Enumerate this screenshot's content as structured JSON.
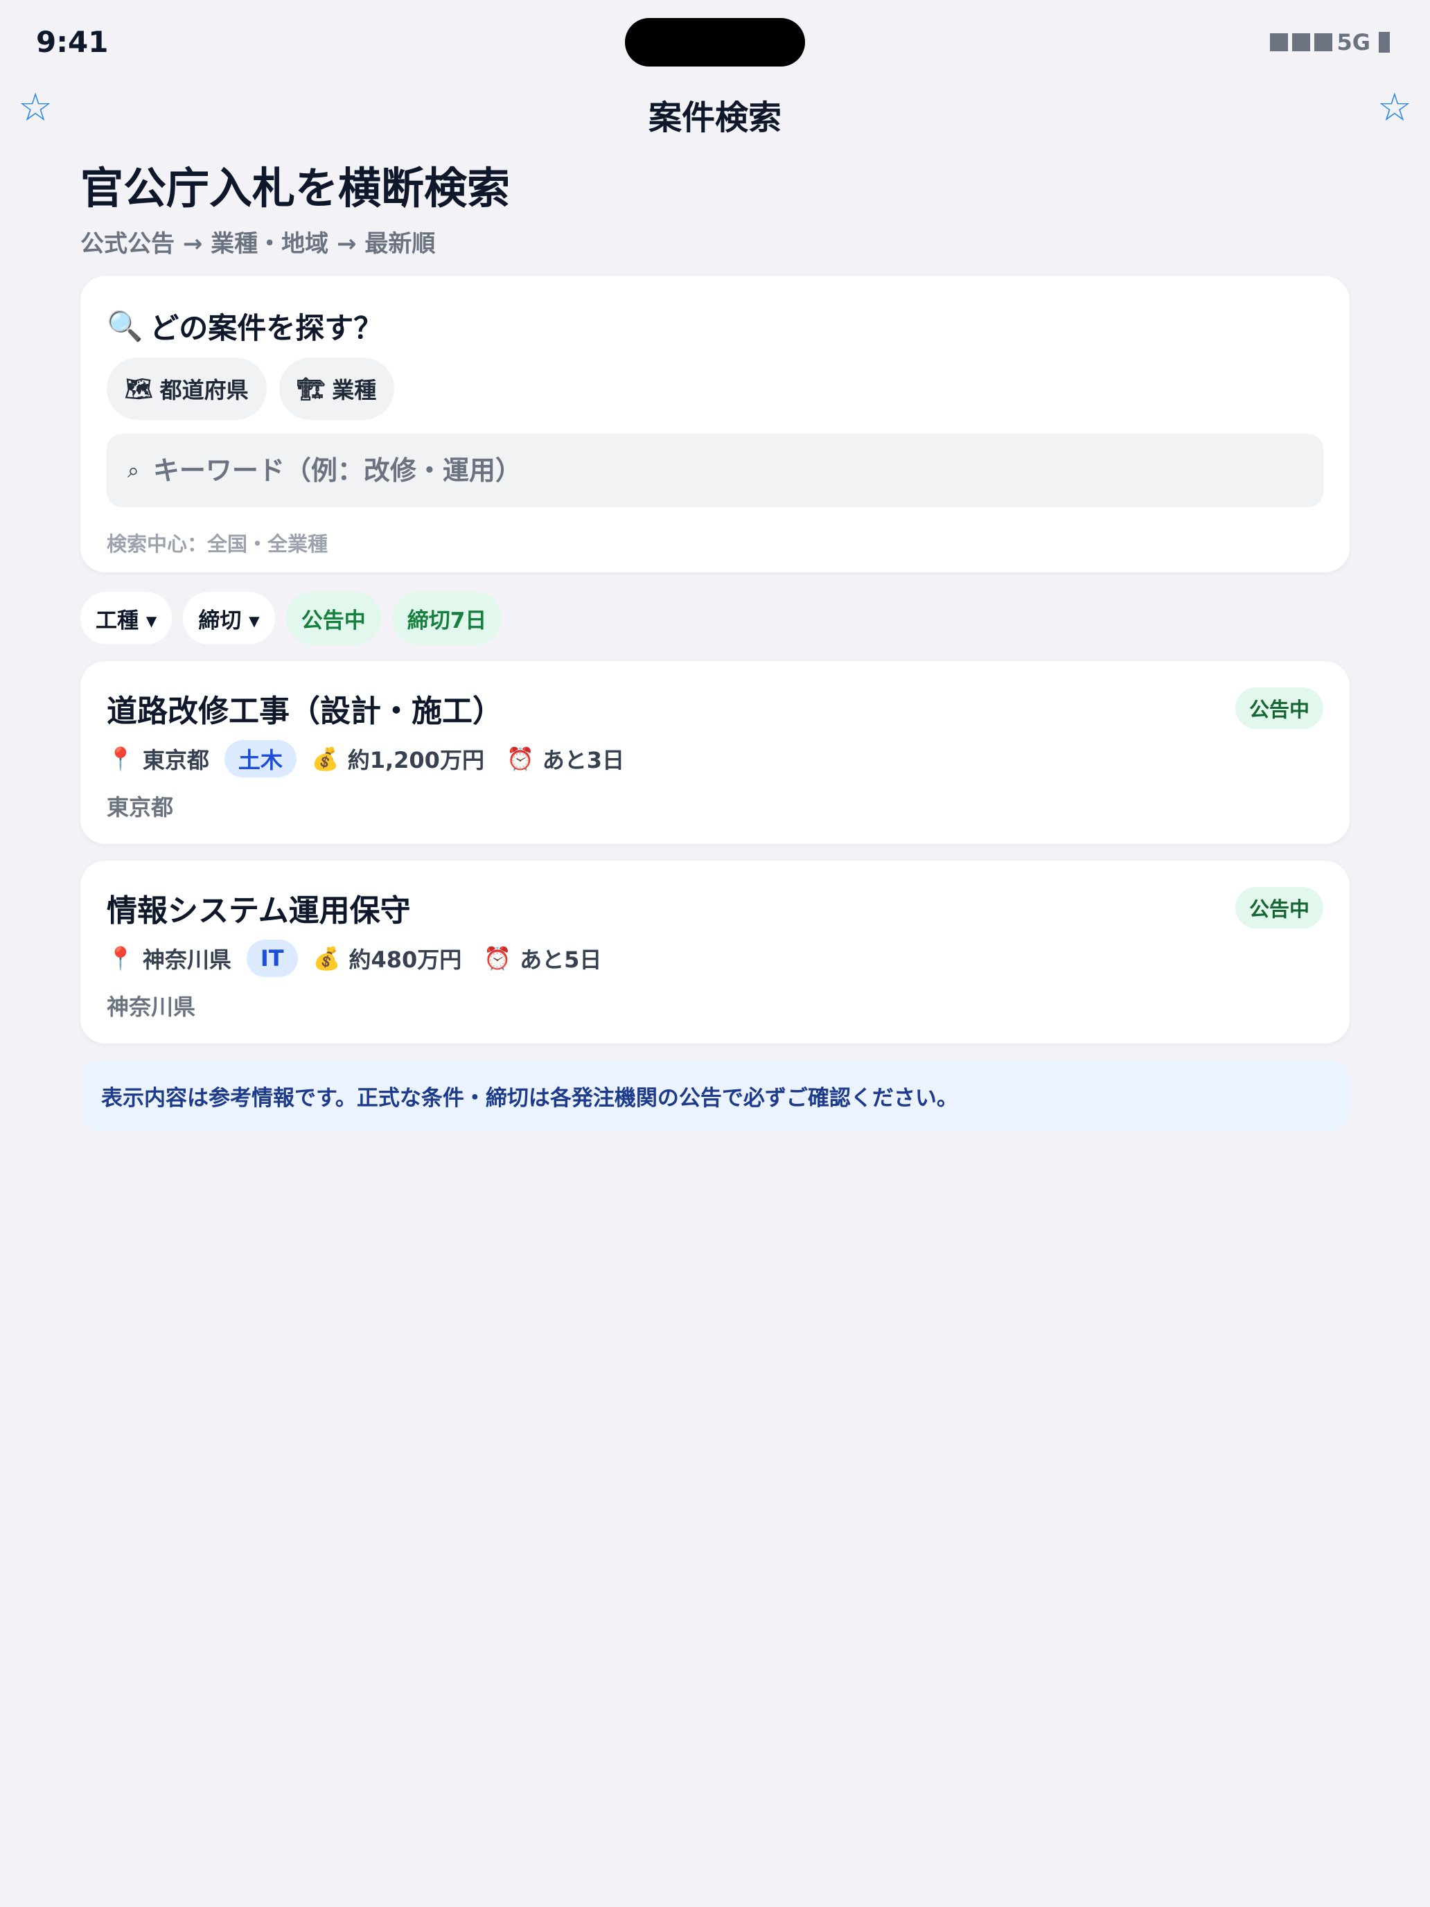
{
  "status_bar": {
    "time": "9:41",
    "network": "5G",
    "signal_icon": "signal-bars-icon",
    "battery_icon": "battery-icon"
  },
  "nav": {
    "title": "案件検索",
    "left_icon": "star-outline-icon",
    "right_icon": "star-outline-icon",
    "star_glyph": "☆",
    "accent_color": "#2b8ae6"
  },
  "hero": {
    "title": "官公庁入札を横断検索",
    "subtitle": "公式公告 → 業種・地域 → 最新順"
  },
  "search": {
    "heading_icon": "🔍",
    "heading": "どの案件を探す？",
    "chips": [
      {
        "icon": "🗺",
        "label": "都道府県",
        "icon_name": "map-icon"
      },
      {
        "icon": "🏗",
        "label": "業種",
        "icon_name": "construction-icon"
      }
    ],
    "keyword_icon": "⌕",
    "keyword_placeholder": "キーワード（例：改修・運用）",
    "keyword_value": "",
    "hint": "検索中心：全国・全業種"
  },
  "filters": [
    {
      "label": "工種 ▾",
      "style": "white"
    },
    {
      "label": "締切 ▾",
      "style": "white"
    },
    {
      "label": "公告中",
      "style": "green"
    },
    {
      "label": "締切7日",
      "style": "green"
    }
  ],
  "tenders": [
    {
      "title": "道路改修工事（設計・施工）",
      "status": "公告中",
      "pin_icon": "📍",
      "prefecture": "東京都",
      "category": "土木",
      "money_icon": "💰",
      "budget": "約1,200万円",
      "clock_icon": "⏰",
      "deadline": "あと3日",
      "location": "東京都"
    },
    {
      "title": "情報システム運用保守",
      "status": "公告中",
      "pin_icon": "📍",
      "prefecture": "神奈川県",
      "category": "IT",
      "money_icon": "💰",
      "budget": "約480万円",
      "clock_icon": "⏰",
      "deadline": "あと5日",
      "location": "神奈川県"
    }
  ],
  "notice": "表示内容は参考情報です。正式な条件・締切は各発注機関の公告で必ずご確認ください。",
  "colors": {
    "background": "#f2f2f7",
    "accent": "#2b8ae6",
    "status_green_bg": "#e3f8ec",
    "status_green_text": "#15803d",
    "tag_blue_bg": "#dbeafe",
    "tag_blue_text": "#1d4ed8",
    "notice_bg": "#eaf3fe",
    "notice_text": "#1e3a8a"
  }
}
